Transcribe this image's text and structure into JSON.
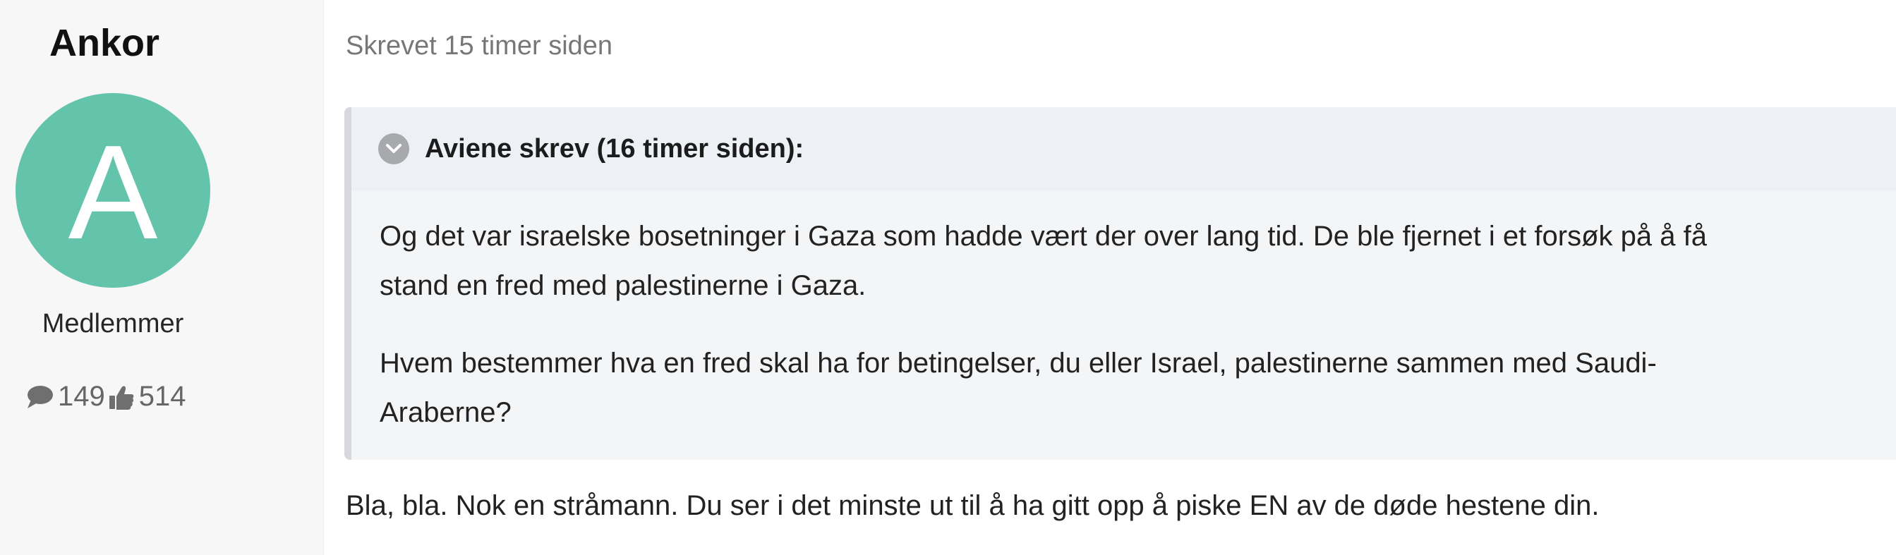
{
  "author": {
    "name": "Ankor",
    "avatar_letter": "A",
    "avatar_color": "#63c4ab",
    "group": "Medlemmer",
    "posts_count": "149",
    "reputation": "514"
  },
  "post": {
    "timestamp": "Skrevet 15 timer siden",
    "quote": {
      "header": "Aviene skrev (16 timer siden):",
      "paragraph1_line1": "Og det var israelske bosetninger i Gaza som hadde vært der over lang tid. De ble fjernet i et forsøk på å få",
      "paragraph1_line2": "stand en fred med palestinerne i Gaza.",
      "paragraph2_line1": "Hvem bestemmer hva en fred skal ha for betingelser, du eller Israel, palestinerne sammen med Saudi-",
      "paragraph2_line2": "Araberne?"
    },
    "reply_text": "Bla, bla. Nok en stråmann. Du ser i det minste ut til å ha gitt opp å piske EN av de døde hestene din."
  },
  "icons": {
    "posts": "speech-bubble-icon",
    "reputation": "thumbs-up-icon",
    "quote_toggle": "chevron-down-icon"
  }
}
